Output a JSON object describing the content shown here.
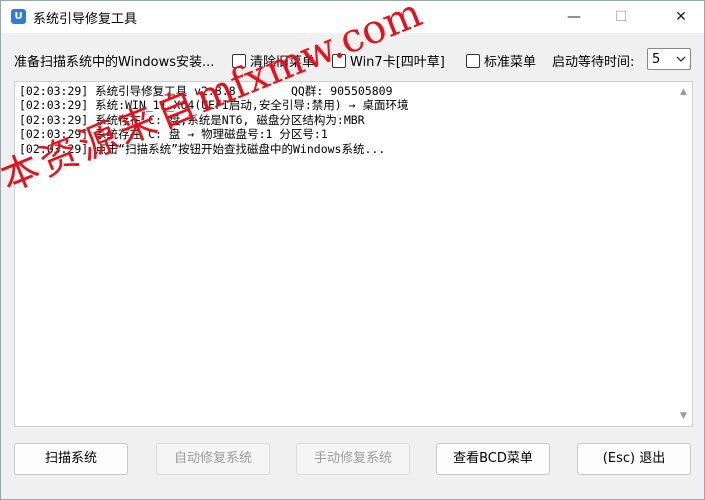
{
  "window": {
    "title": "系统引导修复工具",
    "icon_glyph": "U",
    "controls": {
      "minimize": "—",
      "maximize": "☐",
      "close": "✕"
    }
  },
  "toolbar": {
    "scan_status": "准备扫描系统中的Windows安装...",
    "checkboxes": [
      {
        "label": "清除旧菜单",
        "checked": false
      },
      {
        "label": "Win7卡[四叶草]",
        "checked": false
      },
      {
        "label": "标准菜单",
        "checked": false
      }
    ],
    "wait_label": "启动等待时间:",
    "wait_value": "5"
  },
  "log": {
    "lines": [
      "[02:03:29] 系统引导修复工具 v2.8.8        QQ群: 905505809",
      "[02:03:29] 系统:WIN_11_X64(UEFI启动,安全引导:禁用) → 桌面环境",
      "[02:03:29] 系统存在 C: 盘,系统是NT6, 磁盘分区结构为:MBR",
      "[02:03:29] 系统存在 C: 盘 → 物理磁盘号:1 分区号:1",
      "[02:03:29] 点击“扫描系统”按钮开始查找磁盘中的Windows系统..."
    ]
  },
  "watermark": {
    "cn": "本资源来自",
    "url": "mfxmw.com"
  },
  "buttons": {
    "scan": "扫描系统",
    "auto_repair": "自动修复系统",
    "manual_repair": "手动修复系统",
    "view_bcd": "查看BCD菜单",
    "exit": "(Esc) 退出"
  },
  "colors": {
    "watermark": "#e8101a",
    "accent": "#2e7bd8"
  }
}
